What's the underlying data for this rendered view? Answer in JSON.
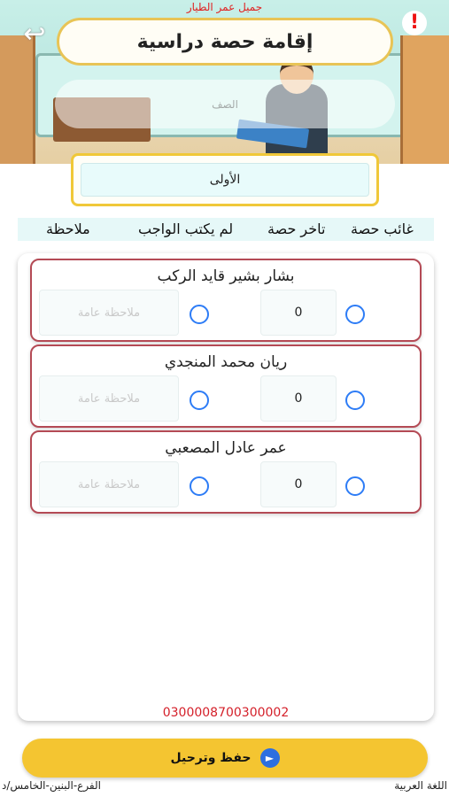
{
  "credit": "جميل عمر الطيار",
  "header": {
    "title": "إقامة حصة دراسية",
    "class_placeholder": "الصف",
    "back_icon": "back-arrow-icon",
    "alert_icon": "exclamation-icon"
  },
  "period": {
    "value": "الأولى"
  },
  "columns": {
    "absent": "غائب حصة",
    "late": "تاخر حصة",
    "homework": "لم يكتب الواجب",
    "note": "ملاحظة"
  },
  "students": [
    {
      "name": "بشار بشير قايد الركب",
      "late": "0",
      "note_placeholder": "ملاحظة عامة"
    },
    {
      "name": "ريان محمد المنجدي",
      "late": "0",
      "note_placeholder": "ملاحظة عامة"
    },
    {
      "name": "عمر عادل المصعبي",
      "late": "0",
      "note_placeholder": "ملاحظة عامة"
    }
  ],
  "code": "0300008700300002",
  "save_button": {
    "label": "حفظ وترحيل",
    "icon": "send-icon"
  },
  "footer": {
    "branch": "الفرع-البنين-الخامس/د",
    "subject": "اللغة العربية"
  },
  "colors": {
    "accent": "#f4c531",
    "card_border": "#b44a55",
    "radio": "#2d7cf6",
    "code": "#d4202a"
  }
}
